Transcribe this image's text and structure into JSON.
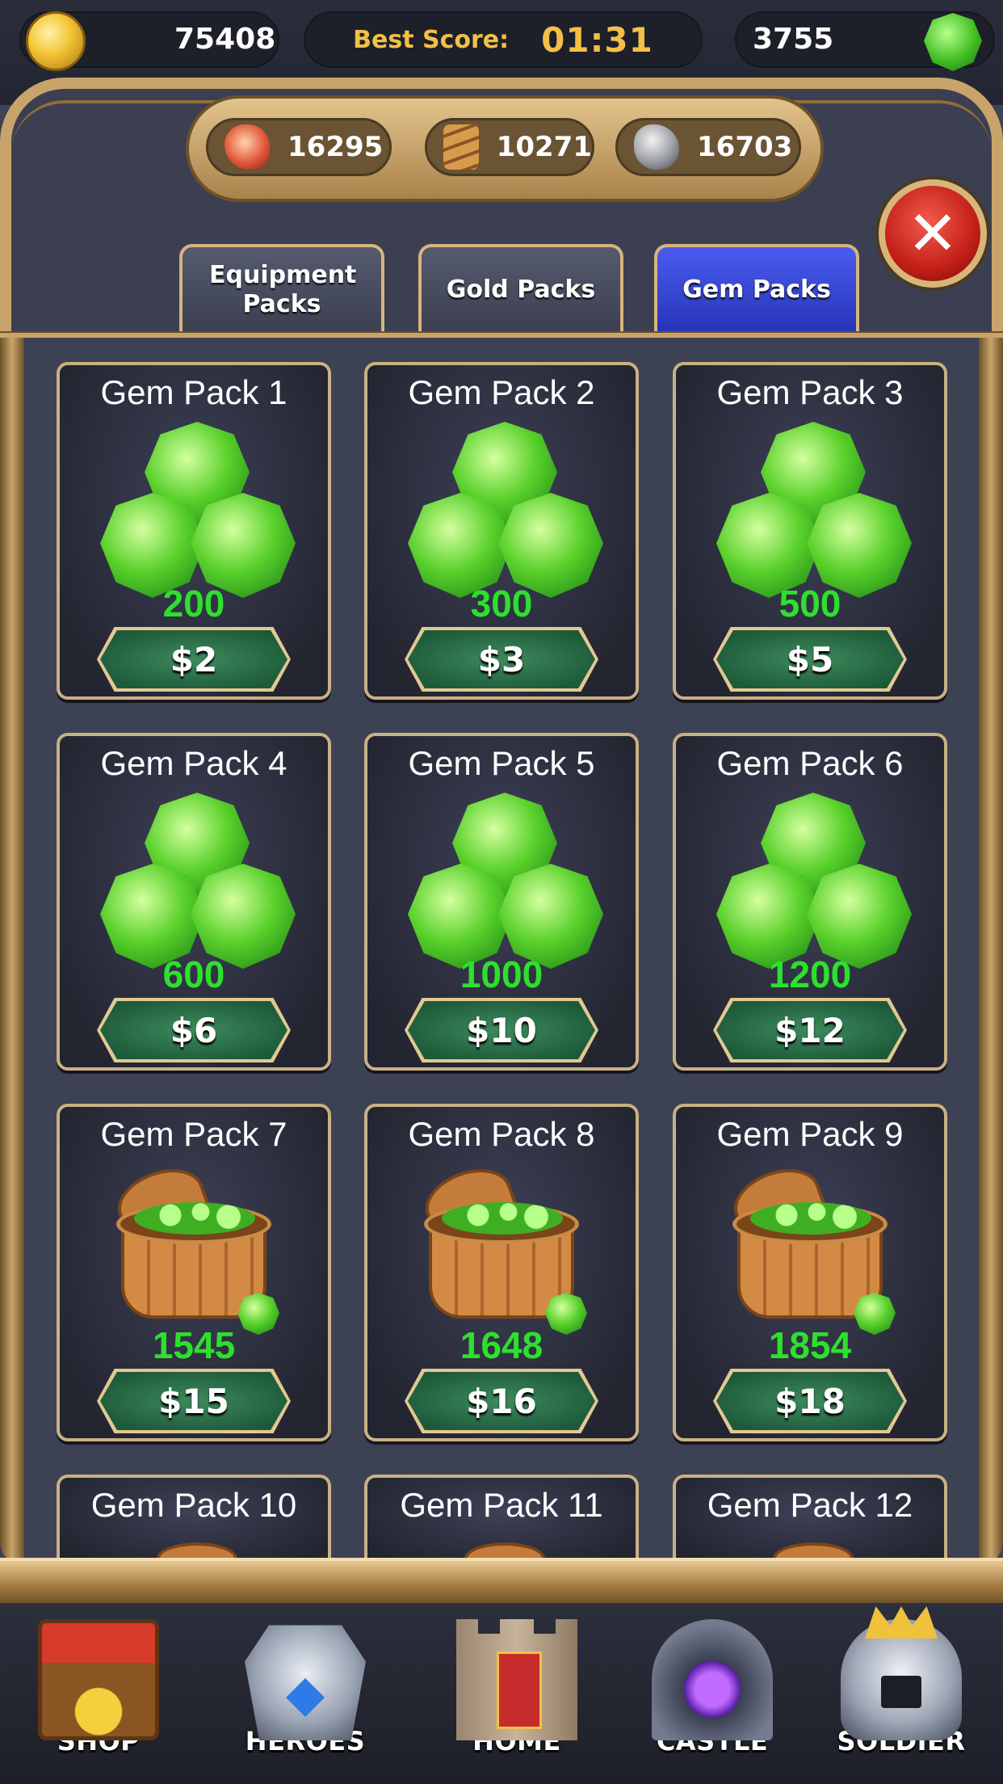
{
  "top_bar": {
    "gold": "75408",
    "best_score_label": "Best Score:",
    "best_score_value": "01:31",
    "gems": "3755"
  },
  "resources": {
    "food": "16295",
    "wood": "10271",
    "stone": "16703"
  },
  "tabs": [
    {
      "label": "Equipment Packs",
      "active": false
    },
    {
      "label": "Gold Packs",
      "active": false
    },
    {
      "label": "Gem Packs",
      "active": true
    }
  ],
  "packs": [
    {
      "title": "Gem Pack 1",
      "amount": "200",
      "price": "$2",
      "icon": "gem-cluster-icon"
    },
    {
      "title": "Gem Pack 2",
      "amount": "300",
      "price": "$3",
      "icon": "gem-cluster-icon"
    },
    {
      "title": "Gem Pack 3",
      "amount": "500",
      "price": "$5",
      "icon": "gem-cluster-icon"
    },
    {
      "title": "Gem Pack 4",
      "amount": "600",
      "price": "$6",
      "icon": "gem-cluster-icon"
    },
    {
      "title": "Gem Pack 5",
      "amount": "1000",
      "price": "$10",
      "icon": "gem-cluster-icon"
    },
    {
      "title": "Gem Pack 6",
      "amount": "1200",
      "price": "$12",
      "icon": "gem-cluster-icon"
    },
    {
      "title": "Gem Pack 7",
      "amount": "1545",
      "price": "$15",
      "icon": "gem-bucket-icon"
    },
    {
      "title": "Gem Pack 8",
      "amount": "1648",
      "price": "$16",
      "icon": "gem-bucket-icon"
    },
    {
      "title": "Gem Pack 9",
      "amount": "1854",
      "price": "$18",
      "icon": "gem-bucket-icon"
    },
    {
      "title": "Gem Pack 10"
    },
    {
      "title": "Gem Pack 11"
    },
    {
      "title": "Gem Pack 12"
    }
  ],
  "nav": [
    {
      "label": "SHOP",
      "icon": "shop-stall-icon"
    },
    {
      "label": "HEROES",
      "icon": "armor-icon"
    },
    {
      "label": "HOME",
      "icon": "tower-icon"
    },
    {
      "label": "CASTLE",
      "icon": "portal-icon"
    },
    {
      "label": "SOLDIER",
      "icon": "helmet-icon"
    }
  ],
  "colors": {
    "background": "#3e4255",
    "frame_gold": "#c9a46a",
    "active_tab": "#3546d8",
    "amount_green": "#2ee02e",
    "best_score": "#f3c046",
    "close_red": "#c21f17"
  }
}
